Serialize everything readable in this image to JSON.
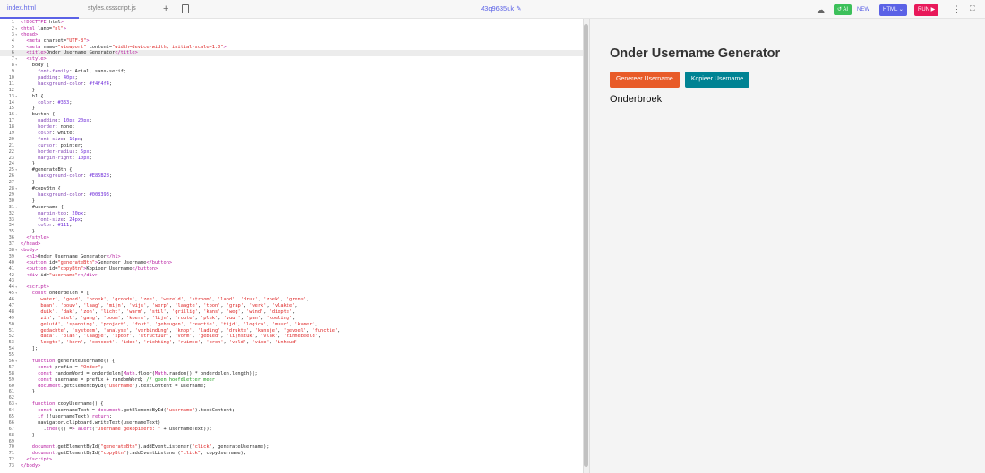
{
  "tabs": [
    {
      "label": "index.html"
    },
    {
      "label": "styles.css"
    },
    {
      "label": "script.js"
    }
  ],
  "toolbar": {
    "add_icon": "+",
    "project_title": "43q9635uk",
    "ai_label": "AI",
    "new_label": "NEW",
    "html_label": "HTML",
    "run_label": "RUN"
  },
  "colors": {
    "accent": "#5b62e6",
    "run": "#e8195a",
    "ai": "#3cc05a",
    "generate": "#E85B28",
    "copy": "#008393"
  },
  "code": {
    "highlight_line": 6,
    "fold_lines": [
      2,
      3,
      7,
      8,
      13,
      16,
      25,
      28,
      31,
      38,
      44,
      45,
      56,
      63
    ],
    "lines": [
      "<!DOCTYPE html>",
      "<html lang=\"nl\">",
      "<head>",
      "  <meta charset=\"UTF-8\">",
      "  <meta name=\"viewport\" content=\"width=device-width, initial-scale=1.0\">",
      "  <title>Onder Username Generator</title>",
      "  <style>",
      "    body {",
      "      font-family: Arial, sans-serif;",
      "      padding: 40px;",
      "      background-color: #f4f4f4;",
      "    }",
      "    h1 {",
      "      color: #333;",
      "    }",
      "    button {",
      "      padding: 10px 20px;",
      "      border: none;",
      "      color: white;",
      "      font-size: 16px;",
      "      cursor: pointer;",
      "      border-radius: 5px;",
      "      margin-right: 10px;",
      "    }",
      "    #generateBtn {",
      "      background-color: #E85B28;",
      "    }",
      "    #copyBtn {",
      "      background-color: #008393;",
      "    }",
      "    #username {",
      "      margin-top: 20px;",
      "      font-size: 24px;",
      "      color: #111;",
      "    }",
      "  </style>",
      "</head>",
      "<body>",
      "  <h1>Onder Username Generator</h1>",
      "  <button id=\"generateBtn\">Genereer Username</button>",
      "  <button id=\"copyBtn\">Kopieer Username</button>",
      "  <div id=\"username\"></div>",
      "",
      "  <script>",
      "    const onderdelen = [",
      "      'water', 'goed', 'broek', 'gronds', 'zee', 'wereld', 'stroom', 'land', 'druk', 'zoek', 'grens',",
      "      'baan', 'bouw', 'laag', 'mijn', 'wijs', 'werp', 'laagte', 'toon', 'grap', 'werk', 'vlakte',",
      "      'duik', 'dak', 'zon', 'licht', 'warm', 'stil', 'grillig', 'kans', 'weg', 'wind', 'diepte',",
      "      'zin', 'stel', 'gang', 'boom', 'koers', 'lijn', 'route', 'plek', 'vuur', 'pan', 'koeling',",
      "      'geluid', 'spanning', 'project', 'fout', 'geheugen', 'reactie', 'tijd', 'logica', 'muur', 'kamer',",
      "      'gedachte', 'systeem', 'analyse', 'verbinding', 'knop', 'lading', 'drukte', 'kansje', 'gevoel', 'functie',",
      "      'data', 'plan', 'laagje', 'spoor', 'structuur', 'vorm', 'gebied', 'lijnstuk', 'vlak', 'zinnebeeld',",
      "      'leegte', 'kern', 'concept', 'idee', 'richting', 'ruimte', 'bron', 'veld', 'vibe', 'inhoud'",
      "    ];",
      "",
      "    function generateUsername() {",
      "      const prefix = \"Onder\";",
      "      const randomWord = onderdelen[Math.floor(Math.random() * onderdelen.length)];",
      "      const username = prefix + randomWord; // geen hoofdletter meer",
      "      document.getElementById(\"username\").textContent = username;",
      "    }",
      "",
      "    function copyUsername() {",
      "      const usernameText = document.getElementById(\"username\").textContent;",
      "      if (!usernameText) return;",
      "      navigator.clipboard.writeText(usernameText)",
      "        .then(() => alert(\"Username gekopieerd: \" + usernameText));",
      "    }",
      "",
      "    document.getElementById(\"generateBtn\").addEventListener(\"click\", generateUsername);",
      "    document.getElementById(\"copyBtn\").addEventListener(\"click\", copyUsername);",
      "  </script>",
      "</body>"
    ]
  },
  "preview": {
    "heading": "Onder Username Generator",
    "generate_label": "Genereer Username",
    "copy_label": "Kopieer Username",
    "username": "Onderbroek"
  }
}
